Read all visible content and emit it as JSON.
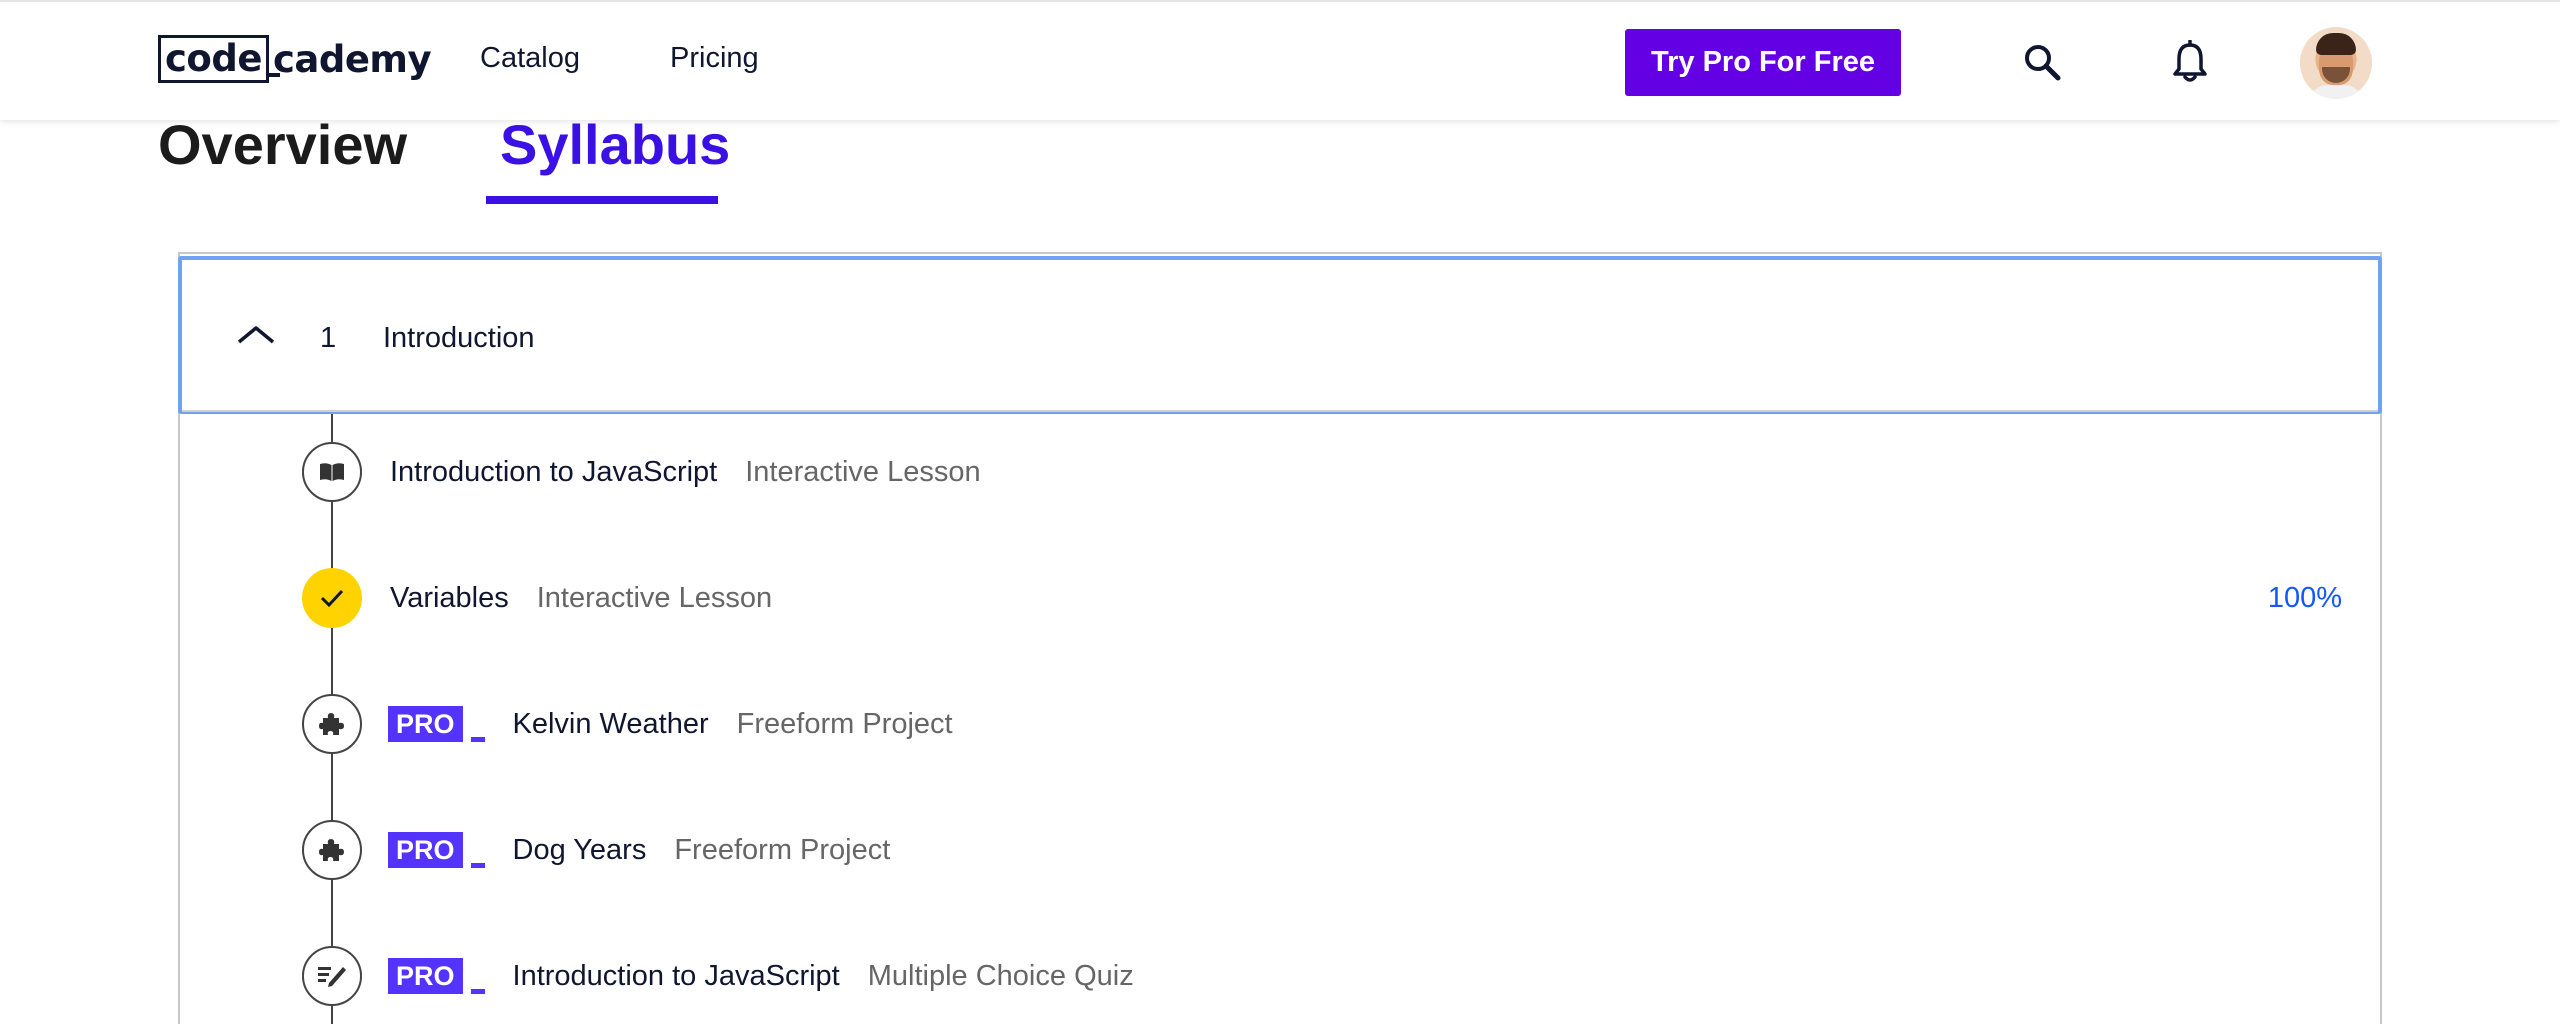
{
  "header": {
    "logo": {
      "boxed": "code",
      "rest": "cademy"
    },
    "nav": {
      "catalog": "Catalog",
      "pricing": "Pricing"
    },
    "cta_label": "Try Pro For Free",
    "icons": [
      "search-icon",
      "bell-icon"
    ],
    "cta_color": "#6400e4"
  },
  "tabs": {
    "overview": "Overview",
    "syllabus": "Syllabus",
    "active": "Syllabus",
    "active_color": "#3a10e5"
  },
  "syllabus": {
    "section": {
      "number": "1",
      "title": "Introduction",
      "expanded": true
    },
    "items": [
      {
        "title": "Introduction to JavaScript",
        "type": "Interactive Lesson",
        "icon": "book-icon",
        "pro": false,
        "completed": false,
        "progress": ""
      },
      {
        "title": "Variables",
        "type": "Interactive Lesson",
        "icon": "check-icon",
        "pro": false,
        "completed": true,
        "progress": "100%"
      },
      {
        "title": "Kelvin Weather",
        "type": "Freeform Project",
        "icon": "puzzle-icon",
        "pro": true,
        "pro_label": "PRO",
        "completed": false,
        "progress": ""
      },
      {
        "title": "Dog Years",
        "type": "Freeform Project",
        "icon": "puzzle-icon",
        "pro": true,
        "pro_label": "PRO",
        "completed": false,
        "progress": ""
      },
      {
        "title": "Introduction to JavaScript",
        "type": "Multiple Choice Quiz",
        "icon": "quiz-icon",
        "pro": true,
        "pro_label": "PRO",
        "completed": false,
        "progress": ""
      }
    ]
  },
  "colors": {
    "pro_badge": "#5533ff",
    "complete_node": "#ffd300",
    "focus_ring": "#6fa2f3",
    "progress_text": "#1557ff"
  }
}
